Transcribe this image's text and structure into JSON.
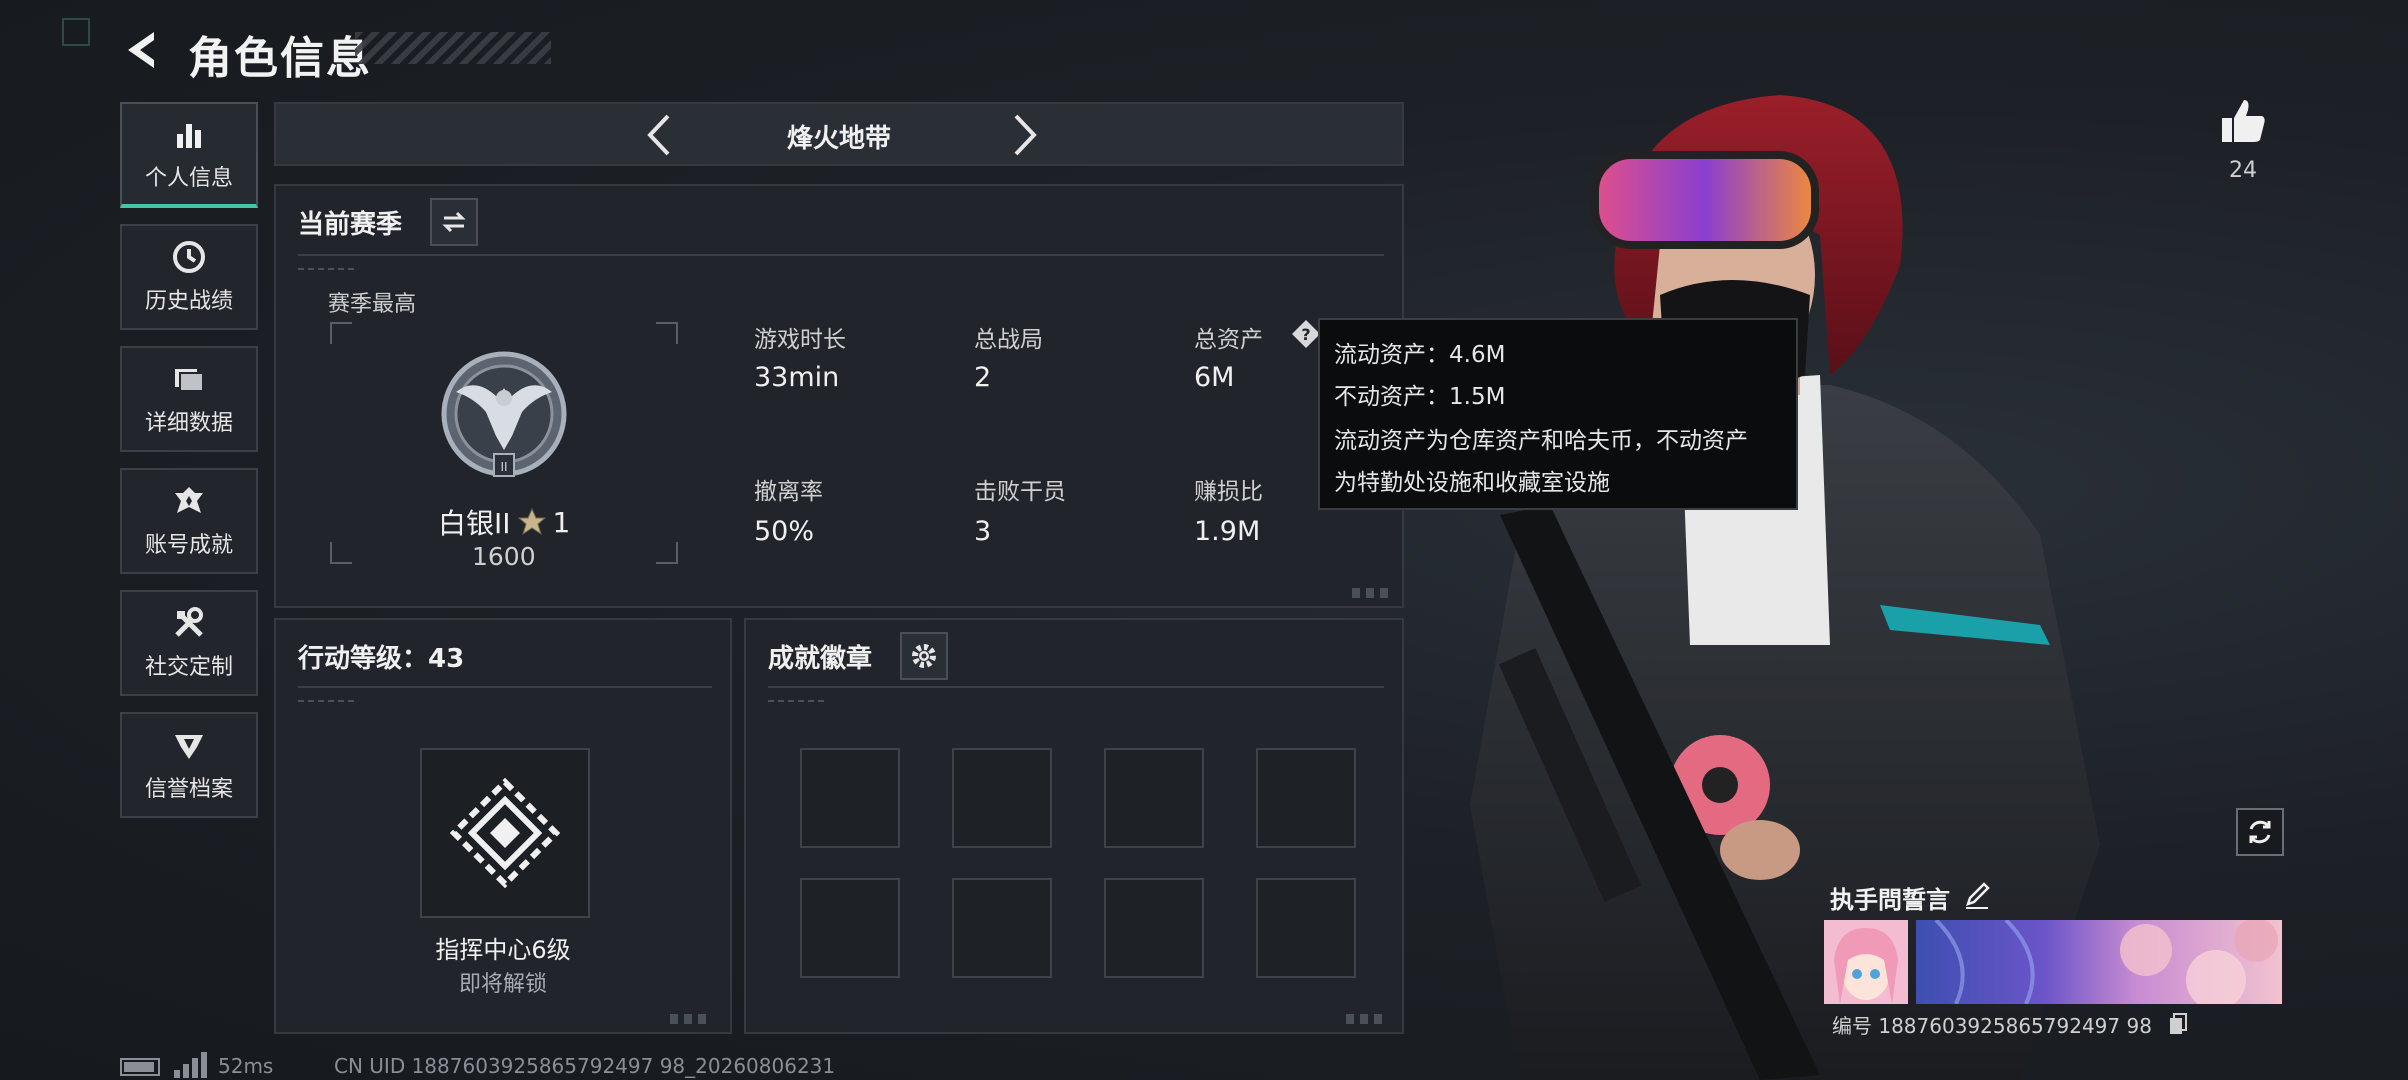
{
  "header": {
    "title": "角色信息"
  },
  "sidebar": {
    "items": [
      {
        "label": "个人信息",
        "icon": "bar-chart-icon",
        "active": true
      },
      {
        "label": "历史战绩",
        "icon": "clock-icon",
        "active": false
      },
      {
        "label": "详细数据",
        "icon": "folder-icon",
        "active": false
      },
      {
        "label": "账号成就",
        "icon": "achievement-icon",
        "active": false
      },
      {
        "label": "社交定制",
        "icon": "tools-icon",
        "active": false
      },
      {
        "label": "信誉档案",
        "icon": "shield-badge-icon",
        "active": false
      }
    ]
  },
  "mode": {
    "name": "烽火地带"
  },
  "season": {
    "title": "当前赛季",
    "best_label": "赛季最高",
    "rank_name": "白银II",
    "rank_stars": "1",
    "rank_score": "1600",
    "stats": [
      {
        "label": "游戏时长",
        "value": "33min"
      },
      {
        "label": "总战局",
        "value": "2"
      },
      {
        "label": "总资产",
        "value": "6M"
      },
      {
        "label": "撤离率",
        "value": "50%"
      },
      {
        "label": "击败干员",
        "value": "3"
      },
      {
        "label": "赚损比",
        "value": "1.9M"
      }
    ]
  },
  "tooltip": {
    "liquid": "流动资产：4.6M",
    "fixed": "不动资产：1.5M",
    "desc_line1": "流动资产为仓库资产和哈夫币，不动资产",
    "desc_line2": "为特勤处设施和收藏室设施"
  },
  "action_level": {
    "title": "行动等级：43",
    "unlock_name": "指挥中心6级",
    "unlock_status": "即将解锁"
  },
  "achievement": {
    "title": "成就徽章",
    "slots": 8
  },
  "right": {
    "like_count": "24",
    "oath_title": "执手問誓言",
    "player_id": "编号 1887603925865792497 98"
  },
  "footer": {
    "ping": "52ms",
    "uid": "CN UID 1887603925865792497 98_20260806231"
  },
  "colors": {
    "accent": "#3fc7a6",
    "panel": "#21252b",
    "border": "#353a41"
  }
}
